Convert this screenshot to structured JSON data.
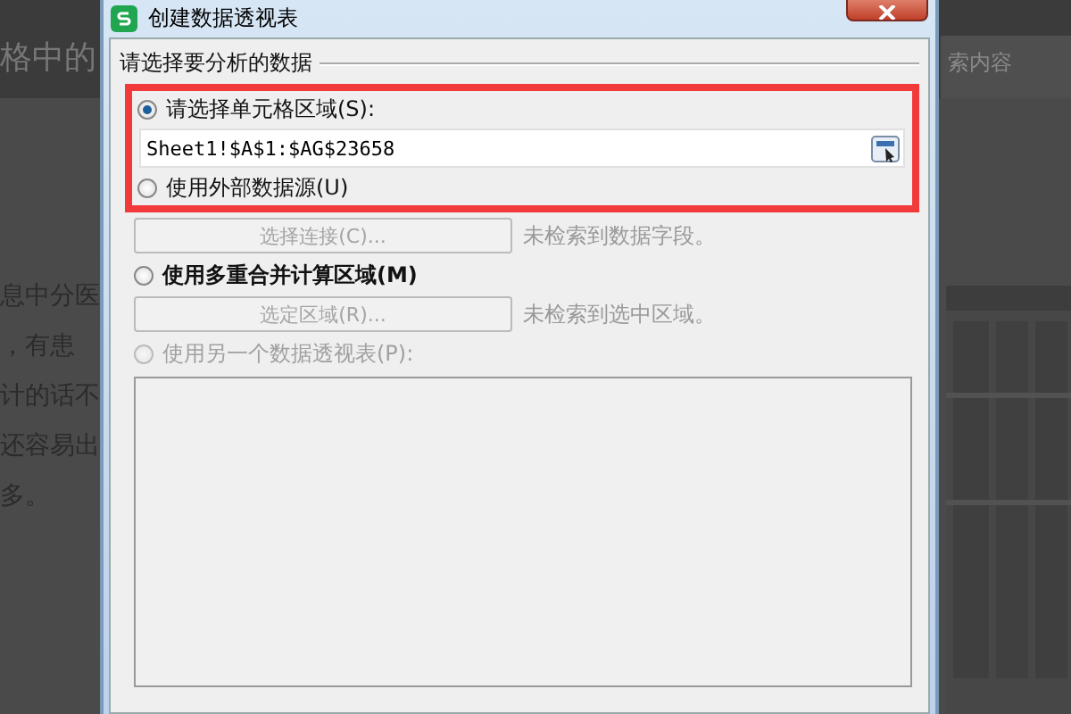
{
  "background": {
    "heading_fragment": "格中的",
    "search_fragment": "索内容",
    "paragraph_lines": [
      "息中分医",
      "，有患",
      "计的话不",
      "还容易出",
      "多。"
    ]
  },
  "dialog": {
    "title": "创建数据透视表",
    "group_label": "请选择要分析的数据",
    "options": [
      {
        "kind": "range",
        "label": "请选择单元格区域(S):",
        "selected": true,
        "disabled": false,
        "emphasized": false,
        "value": "Sheet1!$A$1:$AG$23658",
        "highlighted": true
      },
      {
        "kind": "action",
        "label": "使用外部数据源(U)",
        "selected": false,
        "disabled": false,
        "emphasized": false,
        "button": {
          "label": "选择连接(C)...",
          "disabled": true
        },
        "status": "未检索到数据字段。",
        "highlighted": true
      },
      {
        "kind": "action",
        "label": "使用多重合并计算区域(M)",
        "selected": false,
        "disabled": false,
        "emphasized": true,
        "button": {
          "label": "选定区域(R)...",
          "disabled": true
        },
        "status": "未检索到选中区域。",
        "highlighted": false
      },
      {
        "kind": "list",
        "label": "使用另一个数据透视表(P):",
        "selected": false,
        "disabled": true,
        "emphasized": false,
        "highlighted": false
      }
    ]
  }
}
